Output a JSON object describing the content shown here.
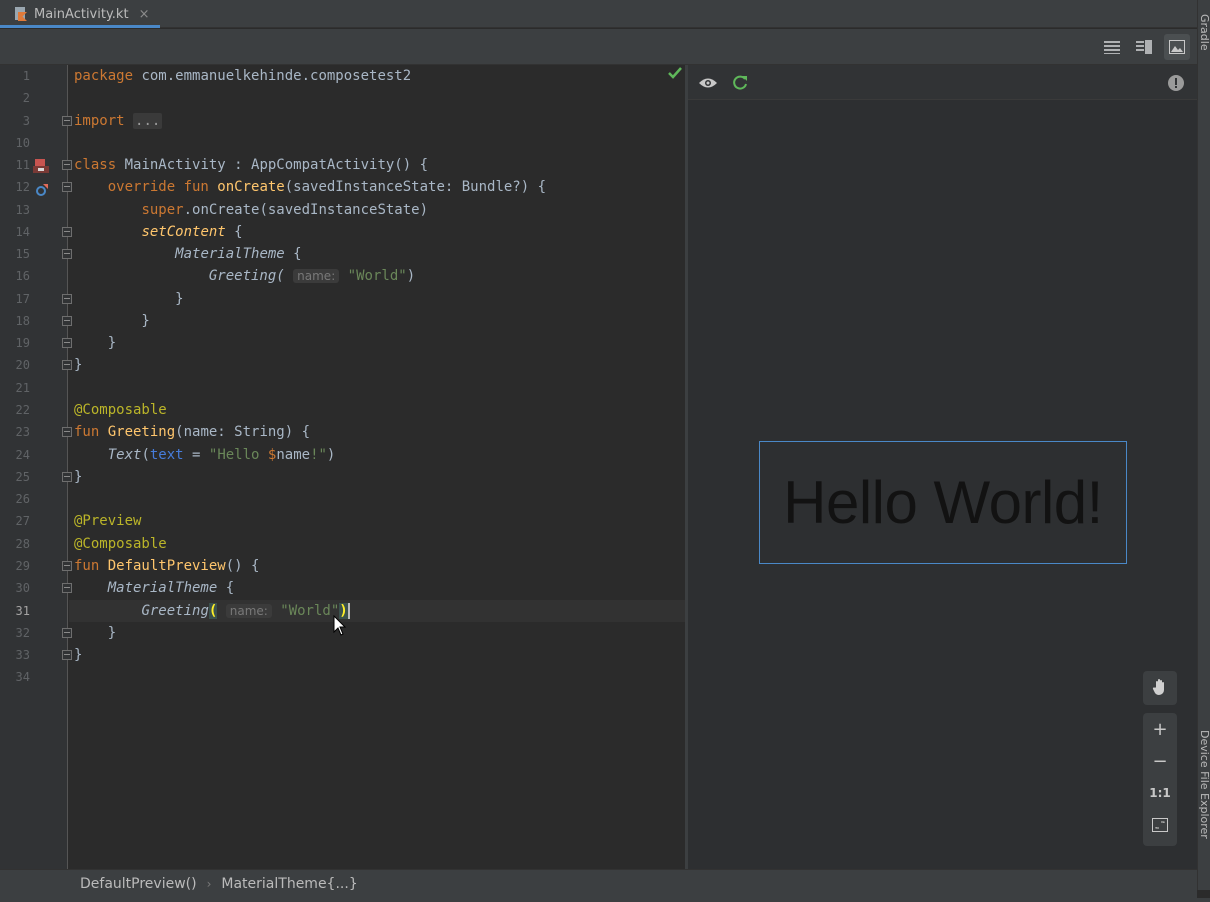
{
  "tab": {
    "label": "MainActivity.kt",
    "close": "×"
  },
  "right_stripe": {
    "top_label": "Gradle",
    "bottom_label": "Device File Explorer"
  },
  "editor": {
    "line_numbers": [
      "1",
      "2",
      "3",
      "10",
      "11",
      "12",
      "13",
      "14",
      "15",
      "16",
      "17",
      "18",
      "19",
      "20",
      "21",
      "22",
      "23",
      "24",
      "25",
      "26",
      "27",
      "28",
      "29",
      "30",
      "31",
      "32",
      "33",
      "34"
    ],
    "code": {
      "l1_kw": "package",
      "l1_rest": " com.emmanuelkehinde.composetest2",
      "l3_kw": "import",
      "l3_folded": "...",
      "l11_kw": "class",
      "l11_rest": " MainActivity : AppCompatActivity() {",
      "l12_indent": "    ",
      "l12_kw": "override fun ",
      "l12_fn": "onCreate",
      "l12_rest": "(savedInstanceState: Bundle?) {",
      "l13_indent": "        ",
      "l13_kw": "super",
      "l13_rest": ".onCreate(savedInstanceState)",
      "l14_indent": "        ",
      "l14_fn": "setContent",
      "l14_rest": " {",
      "l15_indent": "            ",
      "l15_it": "MaterialTheme",
      "l15_rest": " {",
      "l16_indent": "                ",
      "l16_it": "Greeting(",
      "l16_hint": "name:",
      "l16_str": "\"World\"",
      "l16_rest": ")",
      "l17": "            }",
      "l18": "        }",
      "l19": "    }",
      "l20": "}",
      "l22_ann": "@Composable",
      "l23_kw": "fun ",
      "l23_fn": "Greeting",
      "l23_rest": "(name: String) {",
      "l24_indent": "    ",
      "l24_it": "Text",
      "l24_p1": "(",
      "l24_named": "text",
      "l24_p2": " = ",
      "l24_str1": "\"Hello ",
      "l24_kw": "$",
      "l24_name": "name",
      "l24_str2": "!\"",
      "l24_p3": ")",
      "l25": "}",
      "l27_ann": "@Preview",
      "l28_ann": "@Composable",
      "l29_kw": "fun ",
      "l29_fn": "DefaultPreview",
      "l29_rest": "() {",
      "l30_indent": "    ",
      "l30_it": "MaterialTheme",
      "l30_rest": " {",
      "l31_indent": "        ",
      "l31_it": "Greeting",
      "l31_paren": "(",
      "l31_hint": "name:",
      "l31_str": "\"World\"",
      "l31_close": ")",
      "l32": "    }",
      "l33": "}"
    }
  },
  "preview": {
    "text": "Hello World!"
  },
  "zoom": {
    "zoom_in": "+",
    "zoom_out": "−",
    "actual_size": "1:1"
  },
  "breadcrumb": {
    "item1": "DefaultPreview()",
    "separator": "›",
    "item2": "MaterialTheme{...}"
  },
  "colors": {
    "keyword": "#cc7832",
    "function": "#ffc66d",
    "string": "#6a8759",
    "annotation": "#bbb529",
    "named_arg": "#467cda",
    "accent": "#4a88c7",
    "success": "#5fb85a"
  },
  "icons": [
    "kotlin-file-icon",
    "close-icon",
    "list-view-icon",
    "split-view-icon",
    "image-view-icon",
    "checkmark-icon",
    "eye-icon",
    "refresh-icon",
    "warning-icon",
    "pan-hand-icon",
    "zoom-in-icon",
    "zoom-out-icon",
    "actual-size-icon",
    "fit-screen-icon",
    "gutter-run-icon",
    "gutter-override-icon",
    "mouse-cursor-icon"
  ]
}
